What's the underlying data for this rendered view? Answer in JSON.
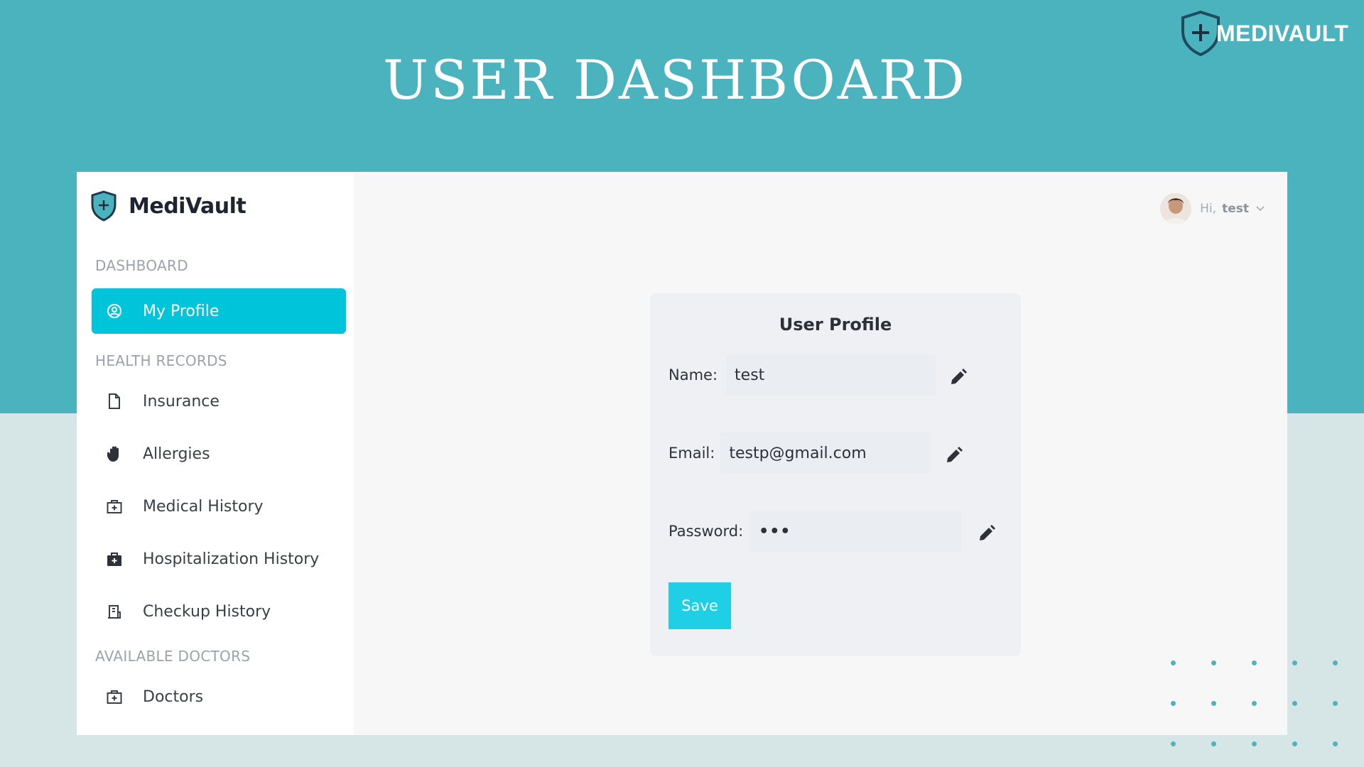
{
  "slide": {
    "title": "USER DASHBOARD",
    "brand": "MEDIVAULT"
  },
  "colors": {
    "teal_band": "#4bb3bd",
    "accent": "#00c4da",
    "save_button": "#1fcfe6",
    "background": "#d6e6e6"
  },
  "sidebar": {
    "app_name": "MediVault",
    "sections": {
      "dashboard": "DASHBOARD",
      "health_records": "HEALTH RECORDS",
      "available_doctors": "AVAILABLE DOCTORS"
    },
    "items": {
      "my_profile": "My Profile",
      "insurance": "Insurance",
      "allergies": "Allergies",
      "medical_history": "Medical History",
      "hospitalization_history": "Hospitalization History",
      "checkup_history": "Checkup History",
      "doctors": "Doctors"
    },
    "icons": {
      "my_profile": "user-circle-icon",
      "insurance": "file-icon",
      "allergies": "hand-icon",
      "medical_history": "medical-kit-icon",
      "hospitalization_history": "medical-bag-icon",
      "checkup_history": "hospital-building-icon",
      "doctors": "medical-kit-icon"
    }
  },
  "header": {
    "greeting": "Hi,",
    "username": "test",
    "menu_icon": "chevron-down-icon"
  },
  "profile_card": {
    "title": "User Profile",
    "name_label": "Name:",
    "name_value": "test",
    "email_label": "Email:",
    "email_value": "testp@gmail.com",
    "password_label": "Password:",
    "password_value": "•••",
    "edit_icon": "pencil-icon",
    "save_label": "Save"
  }
}
